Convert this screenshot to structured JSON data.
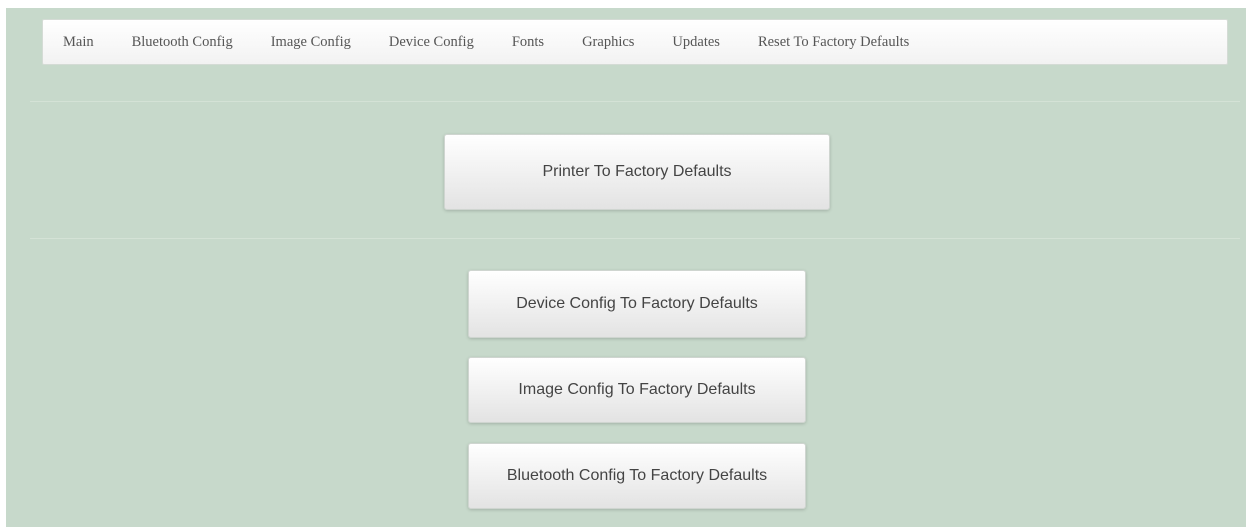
{
  "nav": {
    "items": [
      {
        "label": "Main"
      },
      {
        "label": "Bluetooth Config"
      },
      {
        "label": "Image Config"
      },
      {
        "label": "Device Config"
      },
      {
        "label": "Fonts"
      },
      {
        "label": "Graphics"
      },
      {
        "label": "Updates"
      },
      {
        "label": "Reset To Factory Defaults"
      }
    ]
  },
  "actions": {
    "printer_reset": "Printer To Factory Defaults",
    "device_config_reset": "Device Config To Factory Defaults",
    "image_config_reset": "Image Config To Factory Defaults",
    "bluetooth_config_reset": "Bluetooth Config To Factory Defaults"
  },
  "colors": {
    "page_background": "#c7d9cb",
    "navbar_background": "#ffffff",
    "button_background": "#f0f0f0"
  }
}
